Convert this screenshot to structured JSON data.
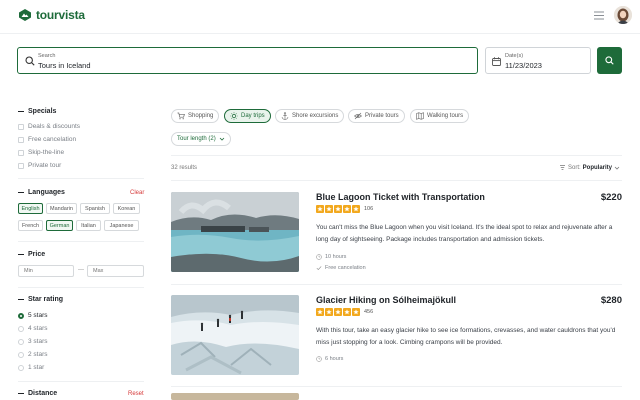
{
  "brand": {
    "name": "tourvista",
    "color": "#1e6b3a"
  },
  "search": {
    "label": "Search",
    "value": "Tours in Iceland"
  },
  "date": {
    "label": "Date(s)",
    "value": "11/23/2023"
  },
  "filters": {
    "specials": {
      "title": "Specials",
      "items": [
        {
          "label": "Deals & discounts",
          "checked": false
        },
        {
          "label": "Free cancelation",
          "checked": false
        },
        {
          "label": "Skip-the-line",
          "checked": false
        },
        {
          "label": "Private tour",
          "checked": false
        }
      ]
    },
    "languages": {
      "title": "Languages",
      "action": "Clear",
      "items": [
        {
          "label": "English",
          "selected": true
        },
        {
          "label": "Mandarin",
          "selected": false
        },
        {
          "label": "Spanish",
          "selected": false
        },
        {
          "label": "Korean",
          "selected": false
        },
        {
          "label": "French",
          "selected": false
        },
        {
          "label": "German",
          "selected": true
        },
        {
          "label": "Italian",
          "selected": false
        },
        {
          "label": "Japanese",
          "selected": false
        }
      ]
    },
    "price": {
      "title": "Price",
      "min_placeholder": "Min",
      "max_placeholder": "Max",
      "separator": "—"
    },
    "star_rating": {
      "title": "Star rating",
      "items": [
        {
          "label": "5 stars",
          "selected": true
        },
        {
          "label": "4 stars",
          "selected": false
        },
        {
          "label": "3 stars",
          "selected": false
        },
        {
          "label": "2 stars",
          "selected": false
        },
        {
          "label": "1 star",
          "selected": false
        }
      ]
    },
    "distance": {
      "title": "Distance",
      "action": "Reset"
    }
  },
  "categories": [
    {
      "label": "Shopping",
      "icon": "cart-icon",
      "selected": false
    },
    {
      "label": "Day trips",
      "icon": "sun-icon",
      "selected": true
    },
    {
      "label": "Shore excursions",
      "icon": "anchor-icon",
      "selected": false
    },
    {
      "label": "Private tours",
      "icon": "eye-off-icon",
      "selected": false
    },
    {
      "label": "Walking tours",
      "icon": "map-icon",
      "selected": false
    }
  ],
  "tour_length": {
    "label": "Tour length (2)"
  },
  "results": {
    "count_text": "32 results",
    "sort_label": "Sort:",
    "sort_value": "Popularity"
  },
  "tours": [
    {
      "title": "Blue Lagoon Ticket with Transportation",
      "price": "$220",
      "rating": 5,
      "reviews": "106",
      "description": "You can't miss the Blue Lagoon when you visit Iceland. It's the ideal spot to relax and rejuvenate after a long day of sightseeing. Package includes transportation and admission tickets.",
      "duration": "10 hours",
      "extra": "Free cancelation"
    },
    {
      "title": "Glacier Hiking on Sólheimajökull",
      "price": "$280",
      "rating": 5,
      "reviews": "456",
      "description": "With this tour, take an easy glacier hike to see ice formations, crevasses, and water cauldrons that you'd miss just stopping for a look. Cimbing crampons will be provided.",
      "duration": "6 hours"
    }
  ]
}
